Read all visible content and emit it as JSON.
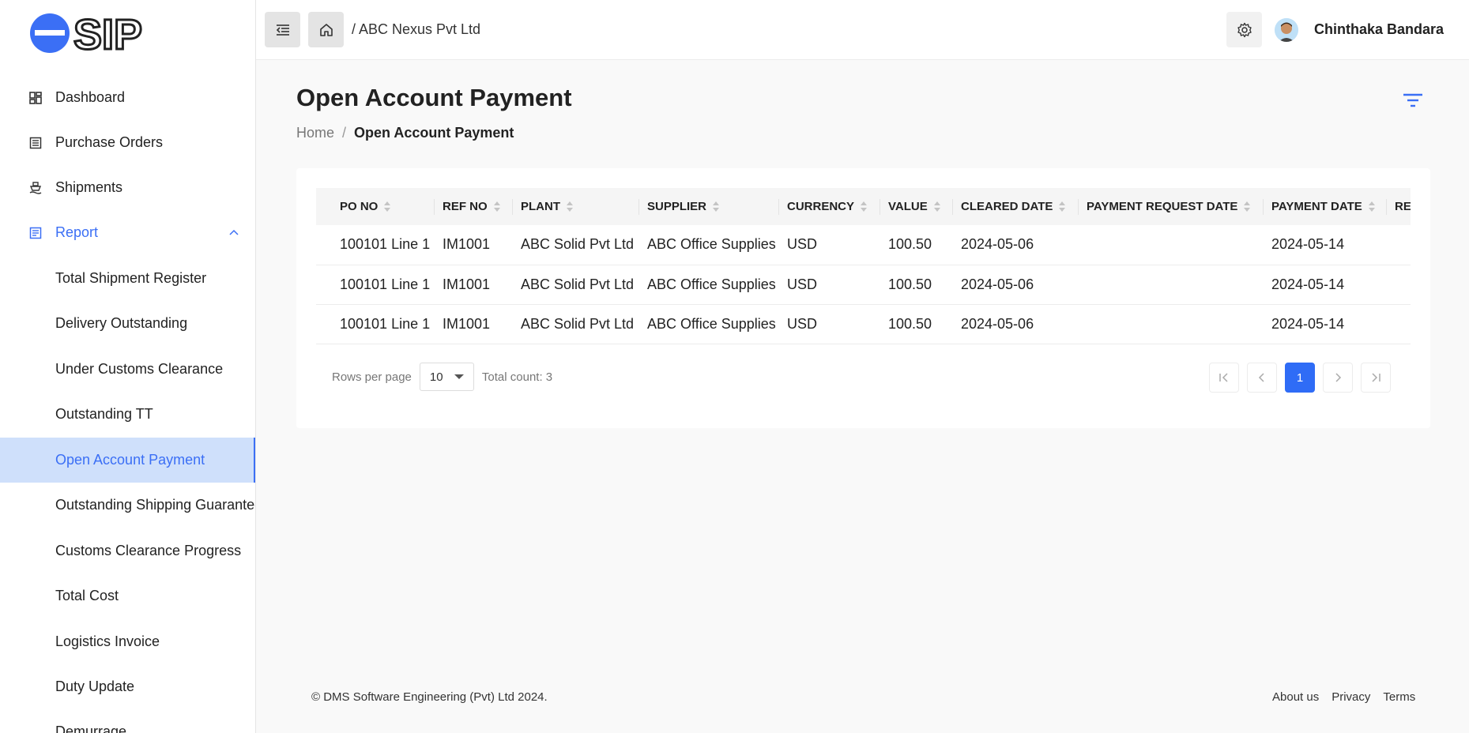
{
  "sidebar": {
    "logo_text": "esip",
    "items": [
      {
        "label": "Dashboard",
        "icon": "dashboard-icon"
      },
      {
        "label": "Purchase Orders",
        "icon": "list-icon"
      },
      {
        "label": "Shipments",
        "icon": "ship-icon"
      },
      {
        "label": "Report",
        "icon": "report-icon"
      }
    ],
    "report_items": [
      "Total Shipment Register",
      "Delivery Outstanding",
      "Under Customs Clearance",
      "Outstanding TT",
      "Open Account Payment",
      "Outstanding Shipping Guarantee",
      "Customs Clearance Progress",
      "Total Cost",
      "Logistics Invoice",
      "Duty Update",
      "Demurrage"
    ],
    "active_item": "Open Account Payment"
  },
  "header": {
    "company": "/ ABC Nexus Pvt Ltd",
    "username": "Chinthaka Bandara"
  },
  "main": {
    "title": "Open Account Payment",
    "breadcrumb": {
      "home": "Home",
      "separator": "/",
      "current": "Open Account Payment"
    }
  },
  "table": {
    "columns": [
      "PO NO",
      "REF NO",
      "PLANT",
      "SUPPLIER",
      "CURRENCY",
      "VALUE",
      "CLEARED DATE",
      "PAYMENT REQUEST DATE",
      "PAYMENT DATE",
      "RE"
    ],
    "rows": [
      [
        "100101 Line 1",
        "IM1001",
        "ABC Solid Pvt Ltd",
        "ABC Office Supplies",
        "USD",
        "100.50",
        "2024-05-06",
        "",
        "2024-05-14",
        ""
      ],
      [
        "100101 Line 1",
        "IM1001",
        "ABC Solid Pvt Ltd",
        "ABC Office Supplies",
        "USD",
        "100.50",
        "2024-05-06",
        "",
        "2024-05-14",
        ""
      ],
      [
        "100101 Line 1",
        "IM1001",
        "ABC Solid Pvt Ltd",
        "ABC Office Supplies",
        "USD",
        "100.50",
        "2024-05-06",
        "",
        "2024-05-14",
        ""
      ]
    ]
  },
  "pagination": {
    "rows_per_page_label": "Rows per page",
    "rows_per_page_value": "10",
    "total_count": "Total count: 3",
    "current_page": "1"
  },
  "footer": {
    "copyright": "© DMS Software Engineering (Pvt) Ltd 2024.",
    "links": [
      "About us",
      "Privacy",
      "Terms"
    ]
  },
  "colors": {
    "accent": "#3b6ff5",
    "active_bg": "#cfe0fb",
    "page_bg": "#f9f9f9"
  }
}
